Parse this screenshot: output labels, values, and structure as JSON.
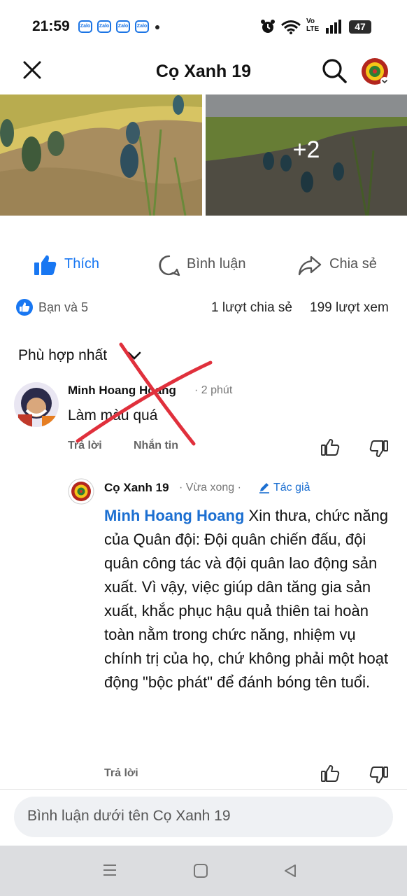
{
  "status_bar": {
    "time": "21:59",
    "notif_icon_label": "Zalo",
    "network_label_top": "Vo",
    "network_label_bottom": "LTE",
    "battery": "47"
  },
  "header": {
    "title": "Cọ Xanh 19"
  },
  "photos": {
    "more_count": "+2"
  },
  "actions": {
    "like": "Thích",
    "comment": "Bình luận",
    "share": "Chia sẻ"
  },
  "stats": {
    "reactions": "Bạn và 5",
    "shares": "1 lượt chia sẻ",
    "views": "199 lượt xem"
  },
  "sort": {
    "label": "Phù hợp nhất"
  },
  "comment1": {
    "author": "Minh Hoang Hoang",
    "time": "· 2 phút",
    "text": "Làm màu quá",
    "reply": "Trả lời",
    "message": "Nhắn tin"
  },
  "reply1": {
    "author": "Cọ Xanh 19",
    "time": "· Vừa xong ·",
    "badge": "Tác giả",
    "mention": "Minh Hoang Hoang",
    "text": " Xin thưa, chức năng của Quân đội: Đội quân chiến đấu, đội quân công tác và đội quân lao động sản xuất. Vì vậy, việc giúp dân tăng gia sản xuất, khắc phục hậu quả thiên tai hoàn toàn nằm trong chức năng, nhiệm vụ chính trị của họ, chứ không phải một hoạt động \"bộc phát\" để đánh bóng tên tuổi.",
    "reply": "Trả lời"
  },
  "composer": {
    "placeholder": "Bình luận dưới tên Cọ Xanh 19"
  },
  "colors": {
    "facebook_blue": "#1877f2",
    "red_cross": "#e0303c"
  }
}
